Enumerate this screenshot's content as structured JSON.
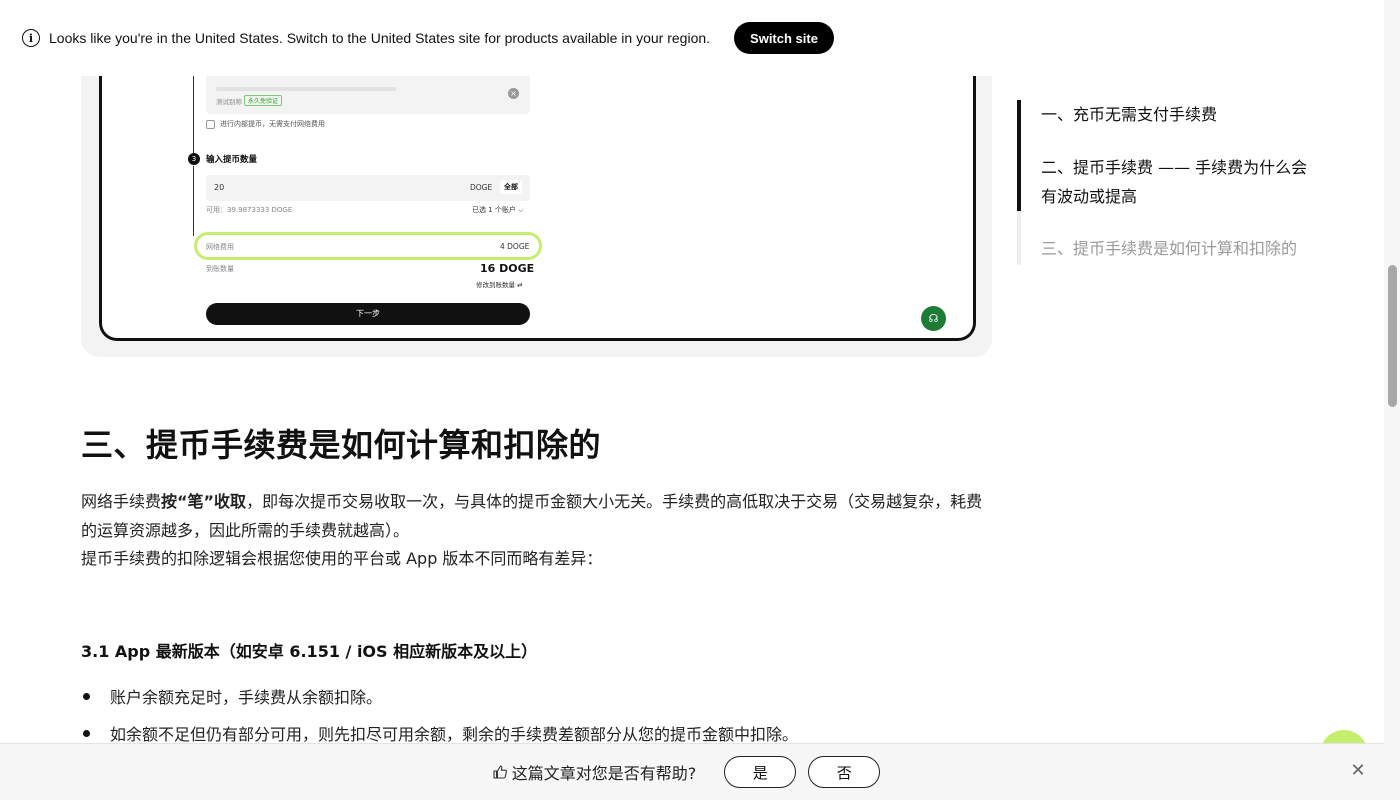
{
  "banner": {
    "message": "Looks like you're in the United States. Switch to the United States site for products available in your region.",
    "switch_label": "Switch site",
    "info_icon": "i"
  },
  "embedded_screenshot": {
    "internal_transfer_text": "进行内部提币，无需支付网络费用",
    "tag_text": "测试别称",
    "badge_text": "永久免验证",
    "step_number": "3",
    "step_title": "输入提币数量",
    "amount": "20",
    "currency": "DOGE",
    "all_label": "全部",
    "available": "可用：39.9873333 DOGE",
    "selected_accounts": "已选 1 个账户 ⌵",
    "fee_label": "网络费用",
    "fee_value": "4 DOGE",
    "receive_label": "到账数量",
    "receive_value": "16 DOGE",
    "modify_label": "修改到账数量 ⇄",
    "next_label": "下一步"
  },
  "article": {
    "section_title": "三、提币手续费是如何计算和扣除的",
    "para1_pre": "网络手续费",
    "para1_bold": "按“笔”收取",
    "para1_post": "，即每次提币交易收取一次，与具体的提币金额大小无关。手续费的高低取决于交易（交易越复杂，耗费的运算资源越多，因此所需的手续费就越高）。",
    "para2": "提币手续费的扣除逻辑会根据您使用的平台或 App 版本不同而略有差异：",
    "subsection_title": "3.1 App 最新版本（如安卓 6.151 / iOS 相应新版本及以上）",
    "bullets": [
      "账户余额充足时，手续费从余额扣除。",
      "如余额不足但仍有部分可用，则先扣尽可用余额，剩余的手续费差额部分从您的提币金额中扣除。"
    ]
  },
  "toc": {
    "items": [
      {
        "label": "一、充币无需支付手续费"
      },
      {
        "label": "二、提币手续费 —— 手续费为什么会有波动或提高"
      },
      {
        "label": "三、提币手续费是如何计算和扣除的"
      }
    ]
  },
  "feedback": {
    "question": "这篇文章对您是否有帮助?",
    "yes_label": "是",
    "no_label": "否",
    "close_glyph": "✕"
  },
  "colors": {
    "accent_green": "#c6ee6e",
    "button_black": "#000000",
    "support_green": "#1e7d34"
  }
}
